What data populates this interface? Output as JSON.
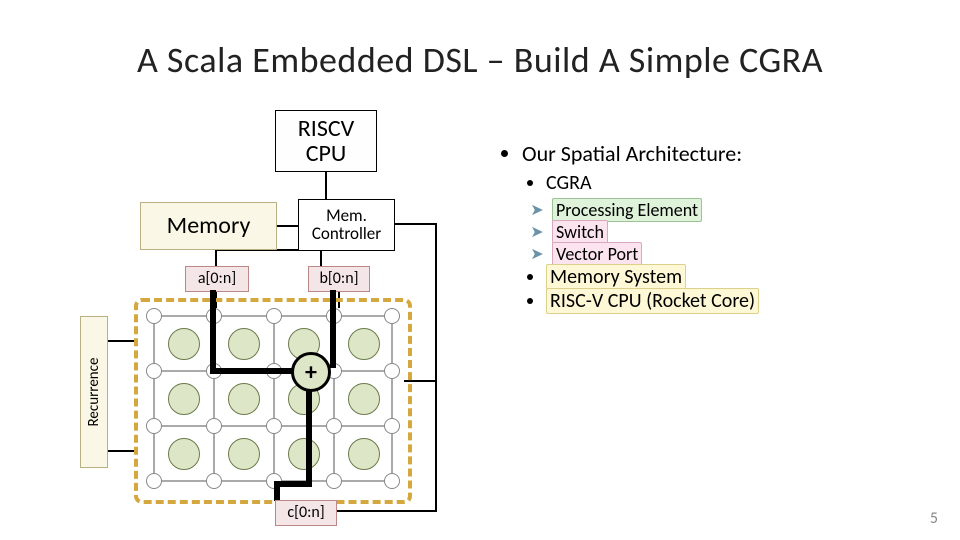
{
  "title": "A Scala Embedded DSL – Build A Simple CGRA",
  "page_number": "5",
  "diagram": {
    "riscv_cpu": "RISCV CPU",
    "memory": "Memory",
    "mem_controller": "Mem. Controller",
    "port_a": "a[0:n]",
    "port_b": "b[0:n]",
    "port_c": "c[0:n]",
    "recurrence": "Recurrence",
    "plus_op": "+"
  },
  "bullets": {
    "heading": "Our Spatial Architecture:",
    "cgra": "CGRA",
    "pe": "Processing Element",
    "switch": "Switch",
    "vport": "Vector Port",
    "memory_system": "Memory System",
    "rocket": "RISC-V CPU (Rocket Core)"
  }
}
